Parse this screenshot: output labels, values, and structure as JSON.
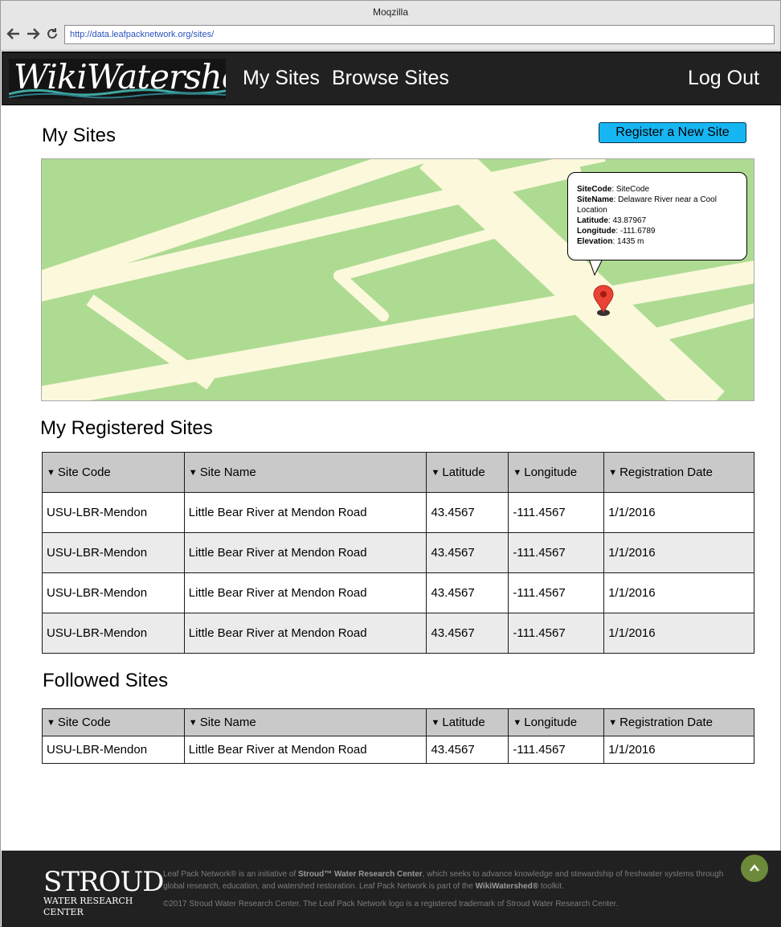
{
  "browser": {
    "title": "Moqzilla",
    "url": "http://data.leafpacknetwork.org/sites/",
    "back_icon": "arrow-left-icon",
    "forward_icon": "arrow-right-icon",
    "reload_icon": "reload-icon"
  },
  "header": {
    "logo_text": "WikiWatershed",
    "nav": [
      "My Sites",
      "Browse Sites"
    ],
    "logout": "Log Out"
  },
  "page": {
    "title": "My Sites",
    "register_button": "Register a New Site"
  },
  "map_popup": {
    "site_code_label": "SiteCode",
    "site_code": ": SiteCode",
    "site_name_label": "SiteName",
    "site_name": ":  Delaware River near a Cool Location",
    "latitude_label": "Latitude",
    "latitude": ": 43.87967",
    "longitude_label": "Longitude",
    "longitude": ": -111.6789",
    "elevation_label": "Elevation",
    "elevation": ":  1435 m"
  },
  "registered": {
    "title": "My Registered Sites",
    "columns": [
      "Site Code",
      "Site Name",
      "Latitude",
      "Longitude",
      "Registration Date"
    ],
    "rows": [
      [
        "USU-LBR-Mendon",
        "Little Bear River at Mendon Road",
        "43.4567",
        "-111.4567",
        "1/1/2016"
      ],
      [
        "USU-LBR-Mendon",
        "Little Bear River at Mendon Road",
        "43.4567",
        "-111.4567",
        "1/1/2016"
      ],
      [
        "USU-LBR-Mendon",
        "Little Bear River at Mendon Road",
        "43.4567",
        "-111.4567",
        "1/1/2016"
      ],
      [
        "USU-LBR-Mendon",
        "Little Bear River at Mendon Road",
        "43.4567",
        "-111.4567",
        "1/1/2016"
      ]
    ]
  },
  "followed": {
    "title": "Followed Sites",
    "columns": [
      "Site Code",
      "Site Name",
      "Latitude",
      "Longitude",
      "Registration Date"
    ],
    "rows": [
      [
        "USU-LBR-Mendon",
        "Little Bear River at Mendon Road",
        "43.4567",
        "-111.4567",
        "1/1/2016"
      ]
    ]
  },
  "footer": {
    "logo_main": "STROUD",
    "logo_sub": "WATER RESEARCH CENTER",
    "text_1": "Leaf Pack Network® is an initiative of ",
    "text_b1": "Stroud™ Water Research Center",
    "text_2": ", which seeks to advance knowledge and stewardship of freshwater systems through global research, education, and watershed restoration. Leaf Pack Network is part of the ",
    "text_b2": "WikiWatershed®",
    "text_3": " toolkit.",
    "copyright": "©2017 Stroud Water Research Center. The Leaf Pack Network logo is a registered trademark of Stroud Water Research Center.",
    "top_icon": "chevron-up-icon"
  },
  "colors": {
    "header_bg": "#222121",
    "register_btn": "#16b6f3",
    "map_land": "#aedb92",
    "map_road": "#fbf8dc",
    "pin": "#ea4335",
    "top_btn": "#6d8a3a"
  },
  "sort_icon": "triangle-down-icon"
}
